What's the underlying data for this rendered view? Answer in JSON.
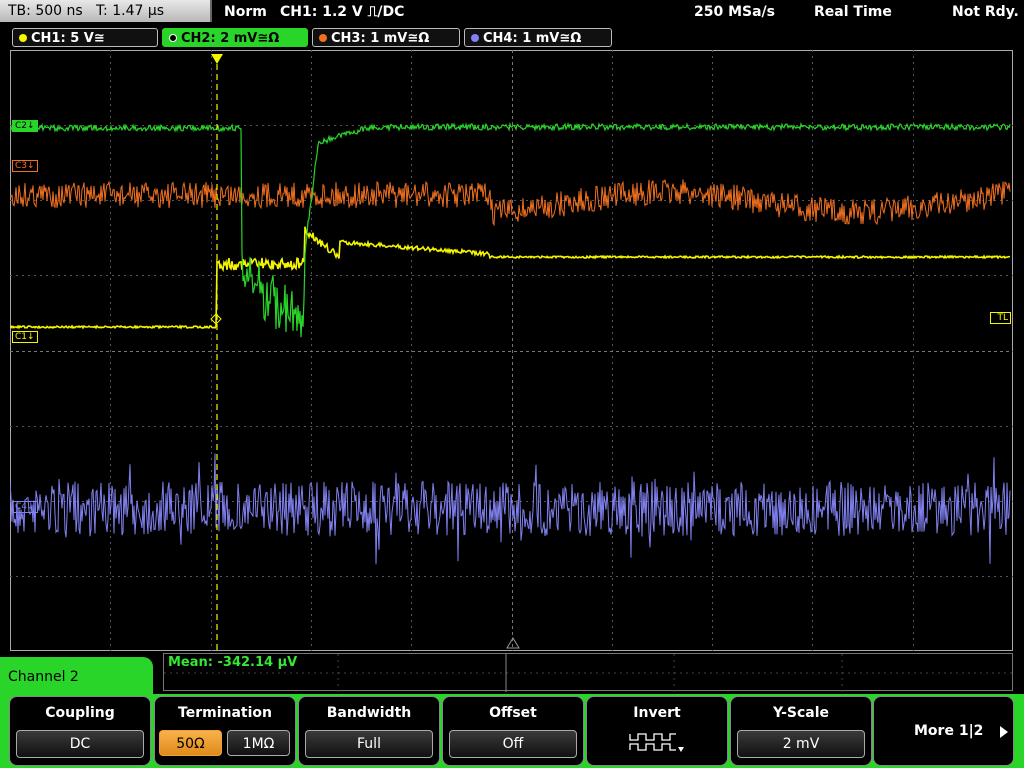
{
  "status": {
    "timebase": "TB: 500 ns",
    "trigger_time": "T: 1.47 µs",
    "mode": "Norm",
    "trigger": "CH1: 1.2 V ⎍/DC",
    "sample_rate": "250 MSa/s",
    "acq_mode": "Real Time",
    "state": "Not Rdy."
  },
  "channels": [
    {
      "label": "CH1: 5 V≅",
      "color": "#f5f500"
    },
    {
      "label": "CH2: 2 mV≅Ω",
      "color": "#2ad52a"
    },
    {
      "label": "CH3: 1 mV≅Ω",
      "color": "#f07020"
    },
    {
      "label": "CH4: 1 mV≅Ω",
      "color": "#8080f0"
    }
  ],
  "markers": {
    "c1": "C1",
    "c2": "C2",
    "c3": "C3",
    "c4": "C4",
    "trigger_level": "TL"
  },
  "measurement": {
    "mean": "Mean: -342.14 µV"
  },
  "menu": {
    "channel": "Channel 2",
    "coupling": {
      "title": "Coupling",
      "value": "DC"
    },
    "termination": {
      "title": "Termination",
      "opt_50": "50Ω",
      "opt_1m": "1MΩ",
      "selected": "50Ω"
    },
    "bandwidth": {
      "title": "Bandwidth",
      "value": "Full"
    },
    "offset": {
      "title": "Offset",
      "value": "Off"
    },
    "invert": {
      "title": "Invert"
    },
    "yscale": {
      "title": "Y-Scale",
      "value": "2 mV"
    },
    "more": "More 1|2"
  },
  "colors": {
    "ch1": "#f5f500",
    "ch2": "#2ad52a",
    "ch3": "#f07020",
    "ch4": "#8080f0",
    "menu_green": "#2ad52a"
  }
}
